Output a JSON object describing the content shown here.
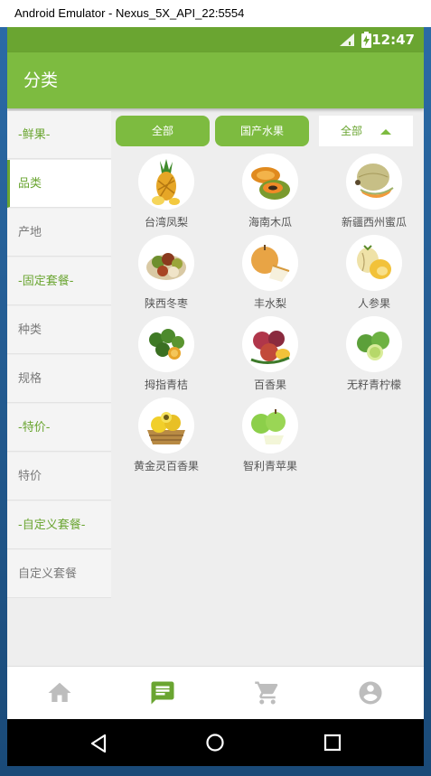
{
  "window": {
    "title": "Android Emulator - Nexus_5X_API_22:5554"
  },
  "status_bar": {
    "time": "12:47"
  },
  "app_bar": {
    "title": "分类"
  },
  "sidebar": {
    "items": [
      {
        "label": "-鲜果-",
        "type": "group"
      },
      {
        "label": "品类",
        "type": "active"
      },
      {
        "label": "产地",
        "type": "item"
      },
      {
        "label": "-固定套餐-",
        "type": "group"
      },
      {
        "label": "种类",
        "type": "item"
      },
      {
        "label": "规格",
        "type": "item"
      },
      {
        "label": "-特价-",
        "type": "group"
      },
      {
        "label": "特价",
        "type": "item"
      },
      {
        "label": "-自定义套餐-",
        "type": "group"
      },
      {
        "label": "自定义套餐",
        "type": "item"
      }
    ]
  },
  "filters": {
    "all_label": "全部",
    "domestic_label": "国产水果",
    "sort_label": "全部"
  },
  "products": [
    {
      "name": "台湾凤梨",
      "icon": "pineapple-icon"
    },
    {
      "name": "海南木瓜",
      "icon": "papaya-icon"
    },
    {
      "name": "新疆西州蜜瓜",
      "icon": "melon-icon"
    },
    {
      "name": "陕西冬枣",
      "icon": "jujube-icon"
    },
    {
      "name": "丰水梨",
      "icon": "pear-icon"
    },
    {
      "name": "人参果",
      "icon": "pepino-icon"
    },
    {
      "name": "拇指青桔",
      "icon": "green-tangerine-icon"
    },
    {
      "name": "百香果",
      "icon": "passion-fruit-icon"
    },
    {
      "name": "无籽青柠檬",
      "icon": "lime-icon"
    },
    {
      "name": "黄金灵百香果",
      "icon": "golden-passion-fruit-icon"
    },
    {
      "name": "智利青苹果",
      "icon": "green-apple-icon"
    }
  ],
  "bottom_nav": {
    "items": [
      {
        "icon": "home-icon",
        "active": false
      },
      {
        "icon": "category-chat-icon",
        "active": true
      },
      {
        "icon": "cart-icon",
        "active": false
      },
      {
        "icon": "account-icon",
        "active": false
      }
    ]
  },
  "colors": {
    "accent": "#7dbb40",
    "accent_dark": "#6aa531",
    "inactive_icon": "#bdbdbd"
  }
}
